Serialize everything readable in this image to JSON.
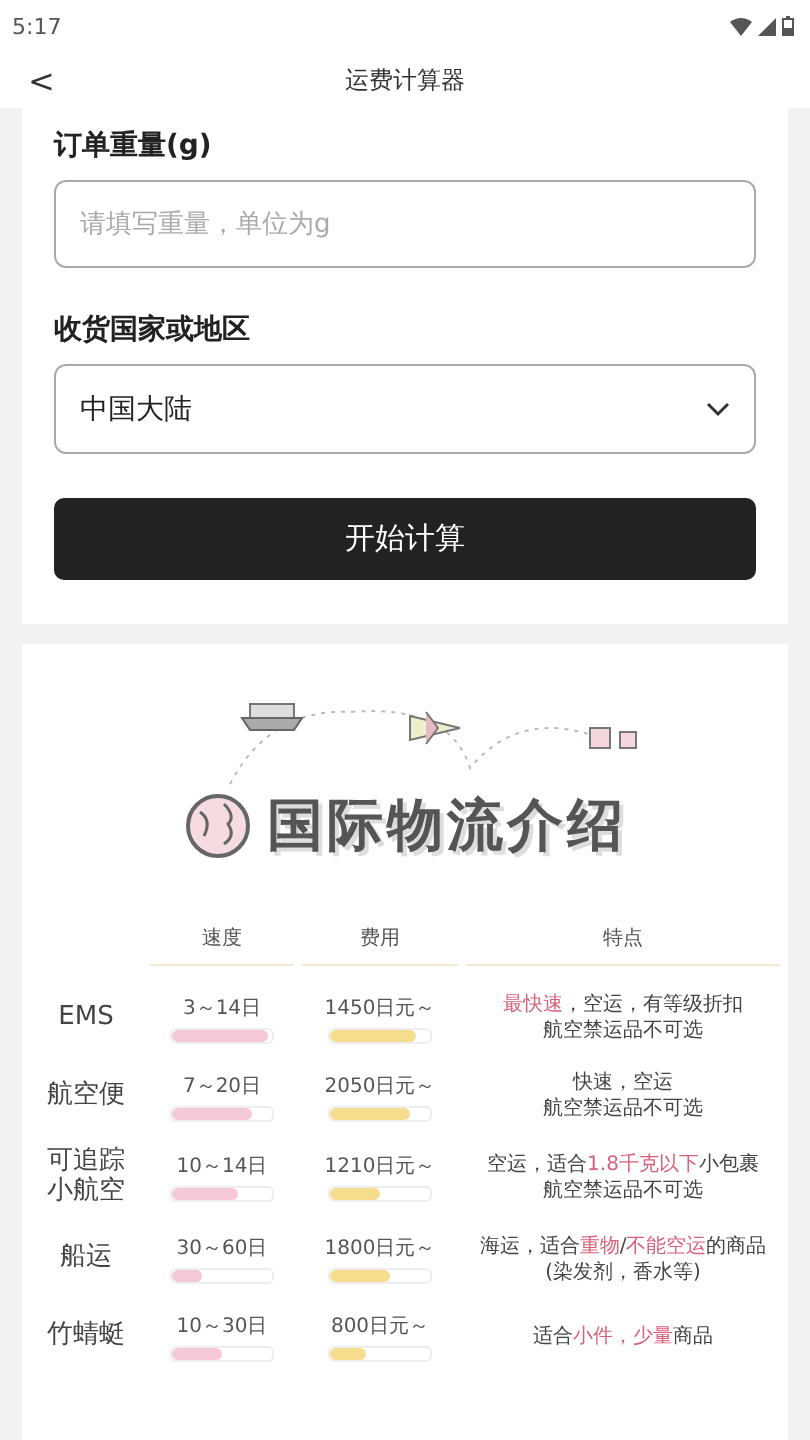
{
  "status_bar": {
    "time": "5:17"
  },
  "header": {
    "back": "<",
    "title": "运费计算器"
  },
  "form": {
    "weight_label": "订单重量(g)",
    "weight_placeholder": "请填写重量，单位为g",
    "country_label": "收货国家或地区",
    "country_value": "中国大陆",
    "submit": "开始计算"
  },
  "intro": {
    "title": "国际物流介绍",
    "columns": [
      "速度",
      "费用",
      "特点"
    ],
    "rows": [
      {
        "name": "EMS",
        "speed": {
          "text": "3～14日",
          "level": 0.95
        },
        "cost": {
          "text": "1450日元～",
          "level": 0.85
        },
        "features": [
          [
            {
              "text": "最快速",
              "highlight": true
            },
            {
              "text": "，空运，有等级折扣",
              "highlight": false
            }
          ],
          [
            {
              "text": "航空禁运品不可选",
              "highlight": false
            }
          ]
        ]
      },
      {
        "name": "航空便",
        "speed": {
          "text": "7～20日",
          "level": 0.8
        },
        "cost": {
          "text": "2050日元～",
          "level": 0.8
        },
        "features": [
          [
            {
              "text": "快速，空运",
              "highlight": false
            }
          ],
          [
            {
              "text": "航空禁运品不可选",
              "highlight": false
            }
          ]
        ]
      },
      {
        "name": "可追踪小航空",
        "speed": {
          "text": "10～14日",
          "level": 0.65
        },
        "cost": {
          "text": "1210日元～",
          "level": 0.5
        },
        "features": [
          [
            {
              "text": "空运，适合",
              "highlight": false
            },
            {
              "text": "1.8千克以下",
              "highlight": true
            },
            {
              "text": "小包裹",
              "highlight": false
            }
          ],
          [
            {
              "text": "航空禁运品不可选",
              "highlight": false
            }
          ]
        ]
      },
      {
        "name": "船运",
        "speed": {
          "text": "30～60日",
          "level": 0.3
        },
        "cost": {
          "text": "1800日元～",
          "level": 0.6
        },
        "features": [
          [
            {
              "text": "海运，适合",
              "highlight": false
            },
            {
              "text": "重物",
              "highlight": true
            },
            {
              "text": "/",
              "highlight": false
            },
            {
              "text": "不能空运",
              "highlight": true
            },
            {
              "text": "的商品",
              "highlight": false
            }
          ],
          [
            {
              "text": "(染发剂，香水等)",
              "highlight": false
            }
          ]
        ]
      },
      {
        "name": "竹蜻蜓",
        "speed": {
          "text": "10～30日",
          "level": 0.5
        },
        "cost": {
          "text": "800日元～",
          "level": 0.35
        },
        "features": [
          [
            {
              "text": "适合",
              "highlight": false
            },
            {
              "text": "小件，",
              "highlight": true
            },
            {
              "text": "少量",
              "highlight": true
            },
            {
              "text": "商品",
              "highlight": false
            }
          ]
        ]
      }
    ]
  }
}
